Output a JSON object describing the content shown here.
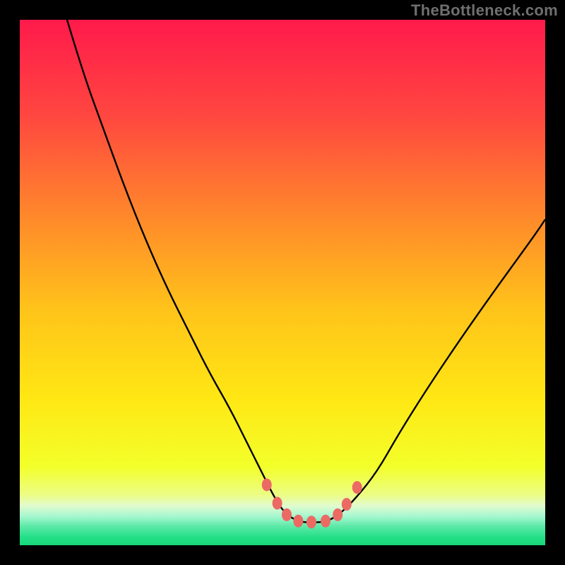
{
  "watermark": "TheBottleneck.com",
  "chart_data": {
    "type": "line",
    "title": "",
    "xlabel": "",
    "ylabel": "",
    "xlim": [
      0,
      100
    ],
    "ylim": [
      0,
      100
    ],
    "grid": false,
    "legend": false,
    "gradient_stops": [
      {
        "offset": 0.0,
        "color": "#ff1a4b"
      },
      {
        "offset": 0.18,
        "color": "#ff4640"
      },
      {
        "offset": 0.38,
        "color": "#ff8a2a"
      },
      {
        "offset": 0.55,
        "color": "#ffc31a"
      },
      {
        "offset": 0.72,
        "color": "#ffe714"
      },
      {
        "offset": 0.85,
        "color": "#f3ff2a"
      },
      {
        "offset": 0.905,
        "color": "#ecfd87"
      },
      {
        "offset": 0.925,
        "color": "#e1fbcf"
      },
      {
        "offset": 0.945,
        "color": "#a6f7d0"
      },
      {
        "offset": 0.965,
        "color": "#59e9a6"
      },
      {
        "offset": 0.985,
        "color": "#23df86"
      },
      {
        "offset": 1.0,
        "color": "#17d97b"
      }
    ],
    "series": [
      {
        "name": "bottleneck-curve",
        "x": [
          9,
          12,
          16,
          20,
          24,
          28,
          32,
          36,
          40,
          43,
          46,
          48.5,
          50.5,
          53,
          55.5,
          58.5,
          61,
          64,
          68,
          72,
          77,
          83,
          90,
          98,
          100
        ],
        "y": [
          100,
          90,
          79,
          68,
          58,
          49,
          41,
          33,
          26,
          20,
          14,
          9,
          6,
          4.5,
          4.3,
          4.5,
          6,
          9,
          14,
          21,
          29,
          38,
          48,
          59,
          62
        ]
      }
    ],
    "markers": {
      "color": "#ec6a64",
      "rx": 7,
      "ry": 9,
      "points": [
        {
          "x": 47.0,
          "y": 11.5
        },
        {
          "x": 49.0,
          "y": 8.0
        },
        {
          "x": 50.8,
          "y": 5.8
        },
        {
          "x": 53.0,
          "y": 4.6
        },
        {
          "x": 55.5,
          "y": 4.4
        },
        {
          "x": 58.2,
          "y": 4.6
        },
        {
          "x": 60.5,
          "y": 5.8
        },
        {
          "x": 62.2,
          "y": 7.8
        },
        {
          "x": 64.2,
          "y": 11.0
        }
      ]
    }
  }
}
